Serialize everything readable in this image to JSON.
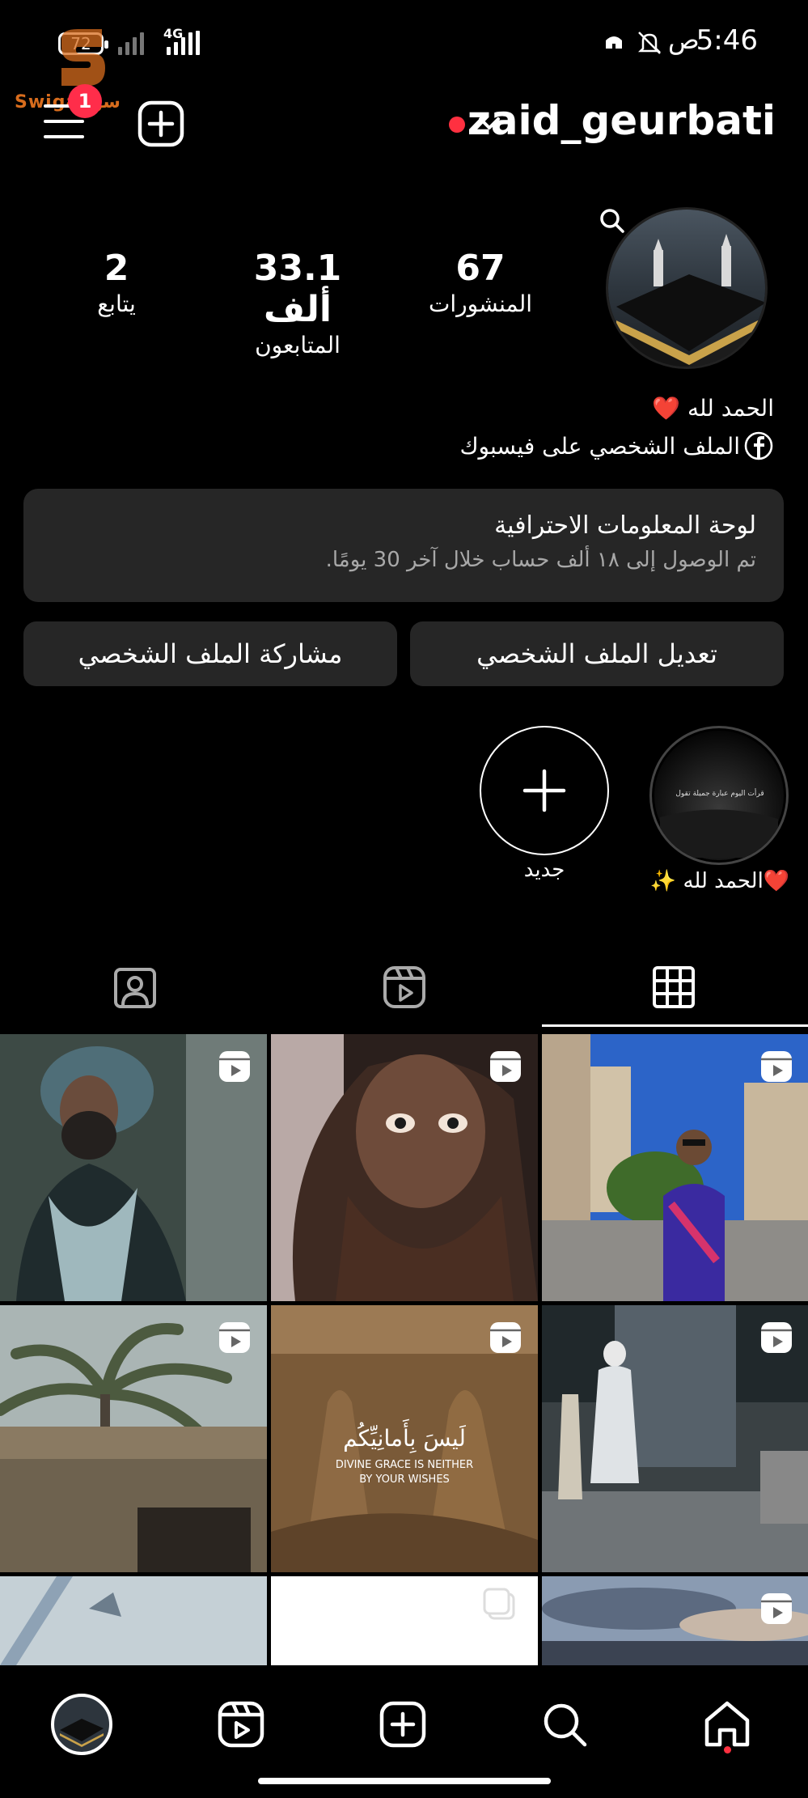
{
  "status_bar": {
    "time": "5:46",
    "am_pm": "ص",
    "battery": "72",
    "network": "4G"
  },
  "watermark": {
    "text": "Swiga سوا"
  },
  "notifications": {
    "menu_badge": "1"
  },
  "profile": {
    "username": "zaid_geurbati",
    "posts_count": "67",
    "posts_label": "المنشورات",
    "followers_count": "33.1 ألف",
    "followers_label": "المتابعون",
    "following_count": "2",
    "following_label": "يتابع",
    "bio_line1": "الحمد لله ❤️",
    "bio_line2": "الملف الشخصي على فيسبوك"
  },
  "pro_dashboard": {
    "title": "لوحة المعلومات الاحترافية",
    "subtitle": "تم الوصول إلى ١٨ ألف حساب خلال آخر 30 يومًا."
  },
  "buttons": {
    "edit_profile": "تعديل الملف الشخصي",
    "share_profile": "مشاركة الملف الشخصي"
  },
  "highlights": [
    {
      "label": "❤️الحمد لله ✨",
      "caption": "قرأت اليوم عبارة جميلة تقول"
    },
    {
      "label": "جديد"
    }
  ],
  "grid": {
    "tile_caption_ar": "لَيسَ بِأَمانِيِّكُم",
    "tile_caption_en_1": "DIVINE GRACE IS NEITHER",
    "tile_caption_en_2": "BY YOUR WISHES"
  },
  "colors": {
    "background": "#000000",
    "card": "#262626",
    "accent_red": "#ff3040",
    "secondary_text": "#a8a8a8"
  }
}
